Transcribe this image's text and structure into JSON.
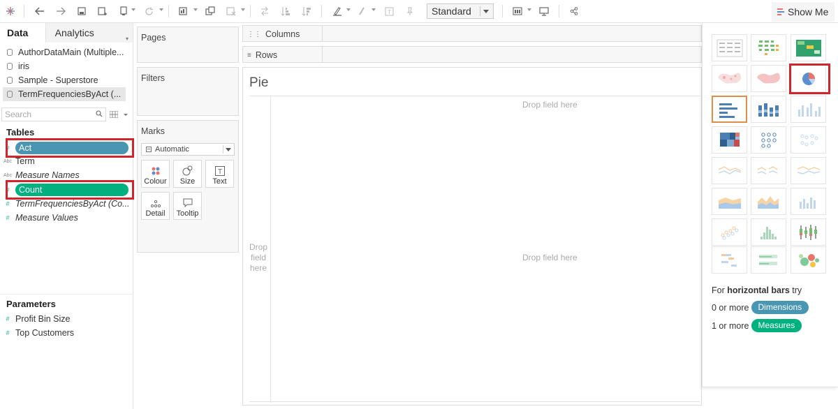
{
  "toolbar": {
    "mark_label_select": "Standard",
    "show_me_label": "Show Me"
  },
  "data_pane": {
    "tabs": [
      "Data",
      "Analytics"
    ],
    "data_sources": [
      "AuthorDataMain (Multiple...",
      "iris",
      "Sample - Superstore",
      "TermFrequenciesByAct (..."
    ],
    "search_placeholder": "Search",
    "tables_header": "Tables",
    "fields": [
      {
        "name": "Act",
        "type_label": "#",
        "kind": "measure-pill-dim"
      },
      {
        "name": "Term",
        "type_label": "Abc",
        "kind": "dimension"
      },
      {
        "name": "Measure Names",
        "type_label": "Abc",
        "kind": "dimension-italic"
      },
      {
        "name": "Count",
        "type_label": "#",
        "kind": "measure-pill"
      },
      {
        "name": "TermFrequenciesByAct (Co...",
        "type_label": "#",
        "kind": "measure-italic"
      },
      {
        "name": "Measure Values",
        "type_label": "#",
        "kind": "measure-italic"
      }
    ],
    "parameters_header": "Parameters",
    "parameters": [
      {
        "name": "Profit Bin Size",
        "type_label": "#"
      },
      {
        "name": "Top Customers",
        "type_label": "#"
      }
    ]
  },
  "shelves": {
    "pages": "Pages",
    "filters": "Filters",
    "marks": "Marks",
    "marks_type": "Automatic",
    "mark_cards": [
      "Colour",
      "Size",
      "Text",
      "Detail",
      "Tooltip"
    ],
    "columns": "Columns",
    "rows": "Rows"
  },
  "view": {
    "title": "Pie",
    "drop_top": "Drop field here",
    "drop_left": [
      "Drop",
      "field",
      "here"
    ],
    "drop_center": "Drop field here"
  },
  "show_me": {
    "hint_prefix": "For ",
    "hint_bold": "horizontal bars",
    "hint_suffix": " try",
    "req_dimensions_prefix": "0 or more",
    "req_dimensions_chip": "Dimensions",
    "req_measures_prefix": "1 or more",
    "req_measures_chip": "Measures"
  },
  "colors": {
    "dimension": "#4996b2",
    "measure": "#00b180",
    "highlight": "#d0252c",
    "selected_chart": "#e08e45"
  }
}
